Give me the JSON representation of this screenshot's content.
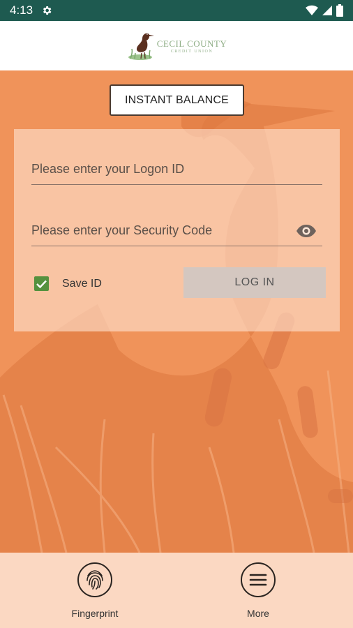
{
  "status_bar": {
    "time": "4:13"
  },
  "header": {
    "logo_name": "CECIL COUNTY",
    "logo_sub": "CREDIT UNION"
  },
  "main": {
    "instant_balance_label": "INSTANT BALANCE",
    "logon_placeholder": "Please enter your Logon ID",
    "security_placeholder": "Please enter your Security Code",
    "save_id_label": "Save ID",
    "save_id_checked": true,
    "login_label": "LOG IN"
  },
  "bottom_nav": {
    "fingerprint_label": "Fingerprint",
    "more_label": "More"
  },
  "colors": {
    "status_bar": "#1e5a50",
    "background": "#f0935a",
    "checkbox": "#55913e",
    "bottom_bar": "#fbd8c2"
  }
}
